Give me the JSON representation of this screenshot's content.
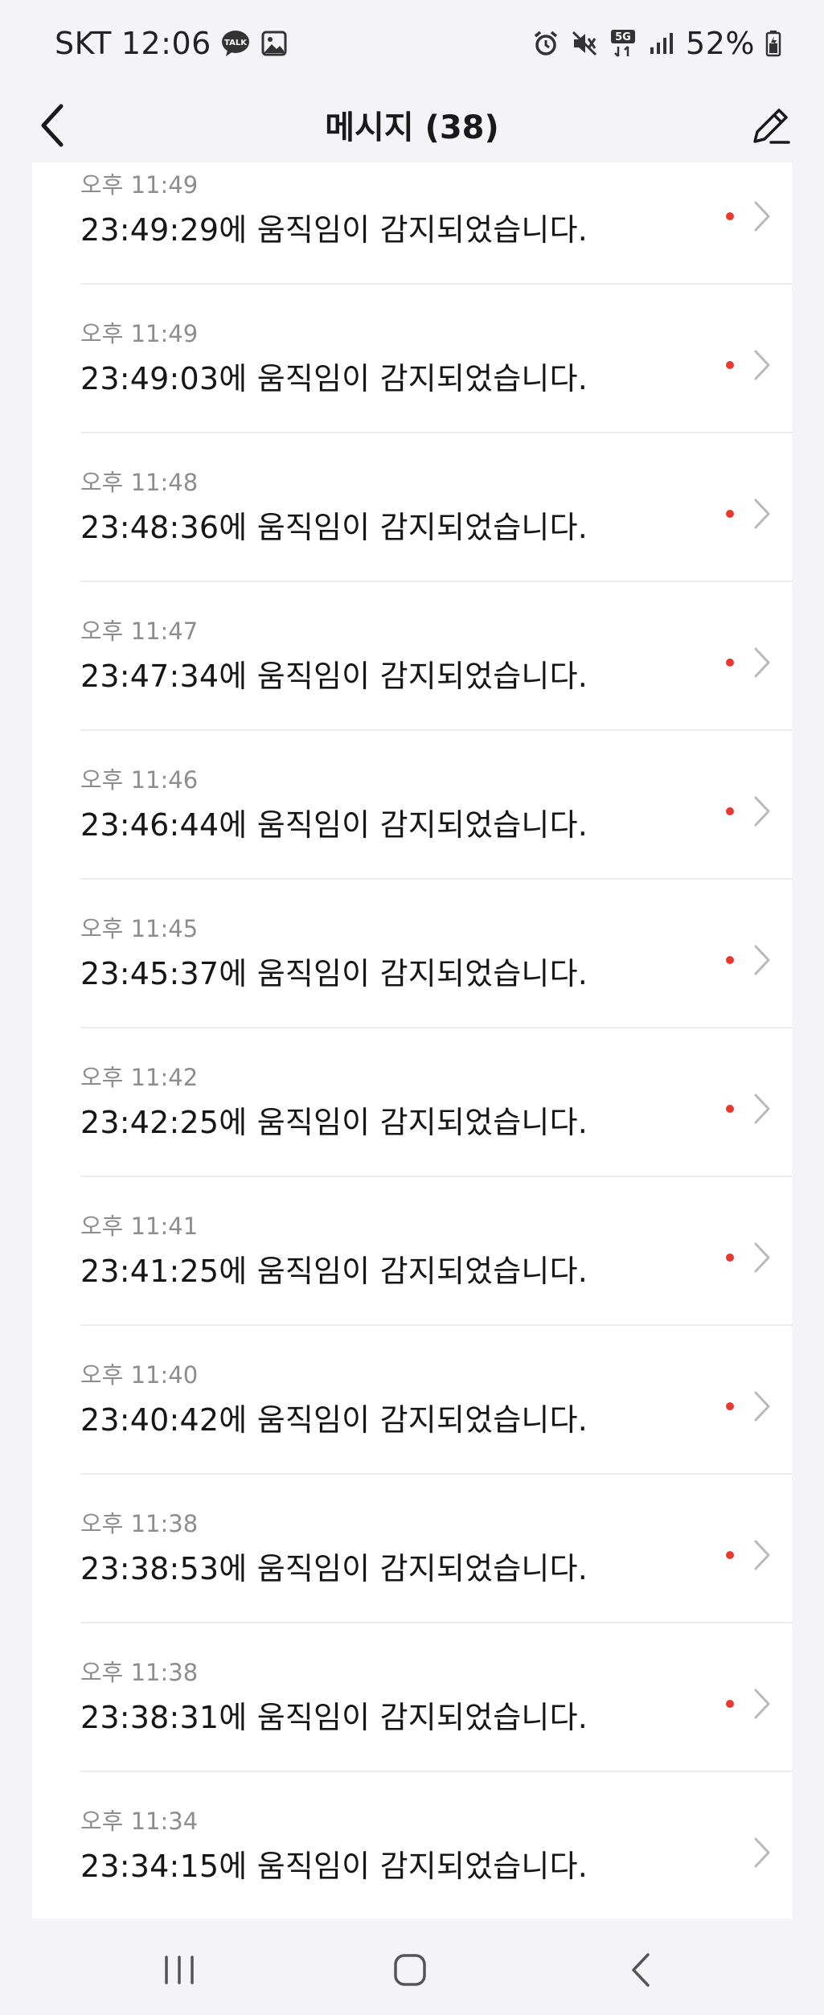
{
  "status_bar": {
    "carrier": "SKT",
    "time": "12:06",
    "talk_badge": "TALK",
    "network": "5G",
    "battery": "52%"
  },
  "header": {
    "title": "메시지 (38)"
  },
  "messages": [
    {
      "time": "오후 11:49",
      "text": "23:49:29에 움직임이 감지되었습니다.",
      "unread": true
    },
    {
      "time": "오후 11:49",
      "text": "23:49:03에 움직임이 감지되었습니다.",
      "unread": true
    },
    {
      "time": "오후 11:48",
      "text": "23:48:36에 움직임이 감지되었습니다.",
      "unread": true
    },
    {
      "time": "오후 11:47",
      "text": "23:47:34에 움직임이 감지되었습니다.",
      "unread": true
    },
    {
      "time": "오후 11:46",
      "text": "23:46:44에 움직임이 감지되었습니다.",
      "unread": true
    },
    {
      "time": "오후 11:45",
      "text": "23:45:37에 움직임이 감지되었습니다.",
      "unread": true
    },
    {
      "time": "오후 11:42",
      "text": "23:42:25에 움직임이 감지되었습니다.",
      "unread": true
    },
    {
      "time": "오후 11:41",
      "text": "23:41:25에 움직임이 감지되었습니다.",
      "unread": true
    },
    {
      "time": "오후 11:40",
      "text": "23:40:42에 움직임이 감지되었습니다.",
      "unread": true
    },
    {
      "time": "오후 11:38",
      "text": "23:38:53에 움직임이 감지되었습니다.",
      "unread": true
    },
    {
      "time": "오후 11:38",
      "text": "23:38:31에 움직임이 감지되었습니다.",
      "unread": true
    },
    {
      "time": "오후 11:34",
      "text": "23:34:15에 움직임이 감지되었습니다.",
      "unread": false
    }
  ],
  "colors": {
    "unread_dot": "#e8392f",
    "background": "#f4f4f8",
    "list_background": "#ffffff"
  },
  "icons": {
    "status": [
      "talk-icon",
      "gallery-icon",
      "alarm-icon",
      "mute-icon",
      "network-5g-icon",
      "signal-icon",
      "battery-icon"
    ],
    "header": [
      "back-arrow-icon",
      "edit-pencil-icon"
    ],
    "nav": [
      "recent-apps-icon",
      "home-icon",
      "back-icon"
    ]
  }
}
